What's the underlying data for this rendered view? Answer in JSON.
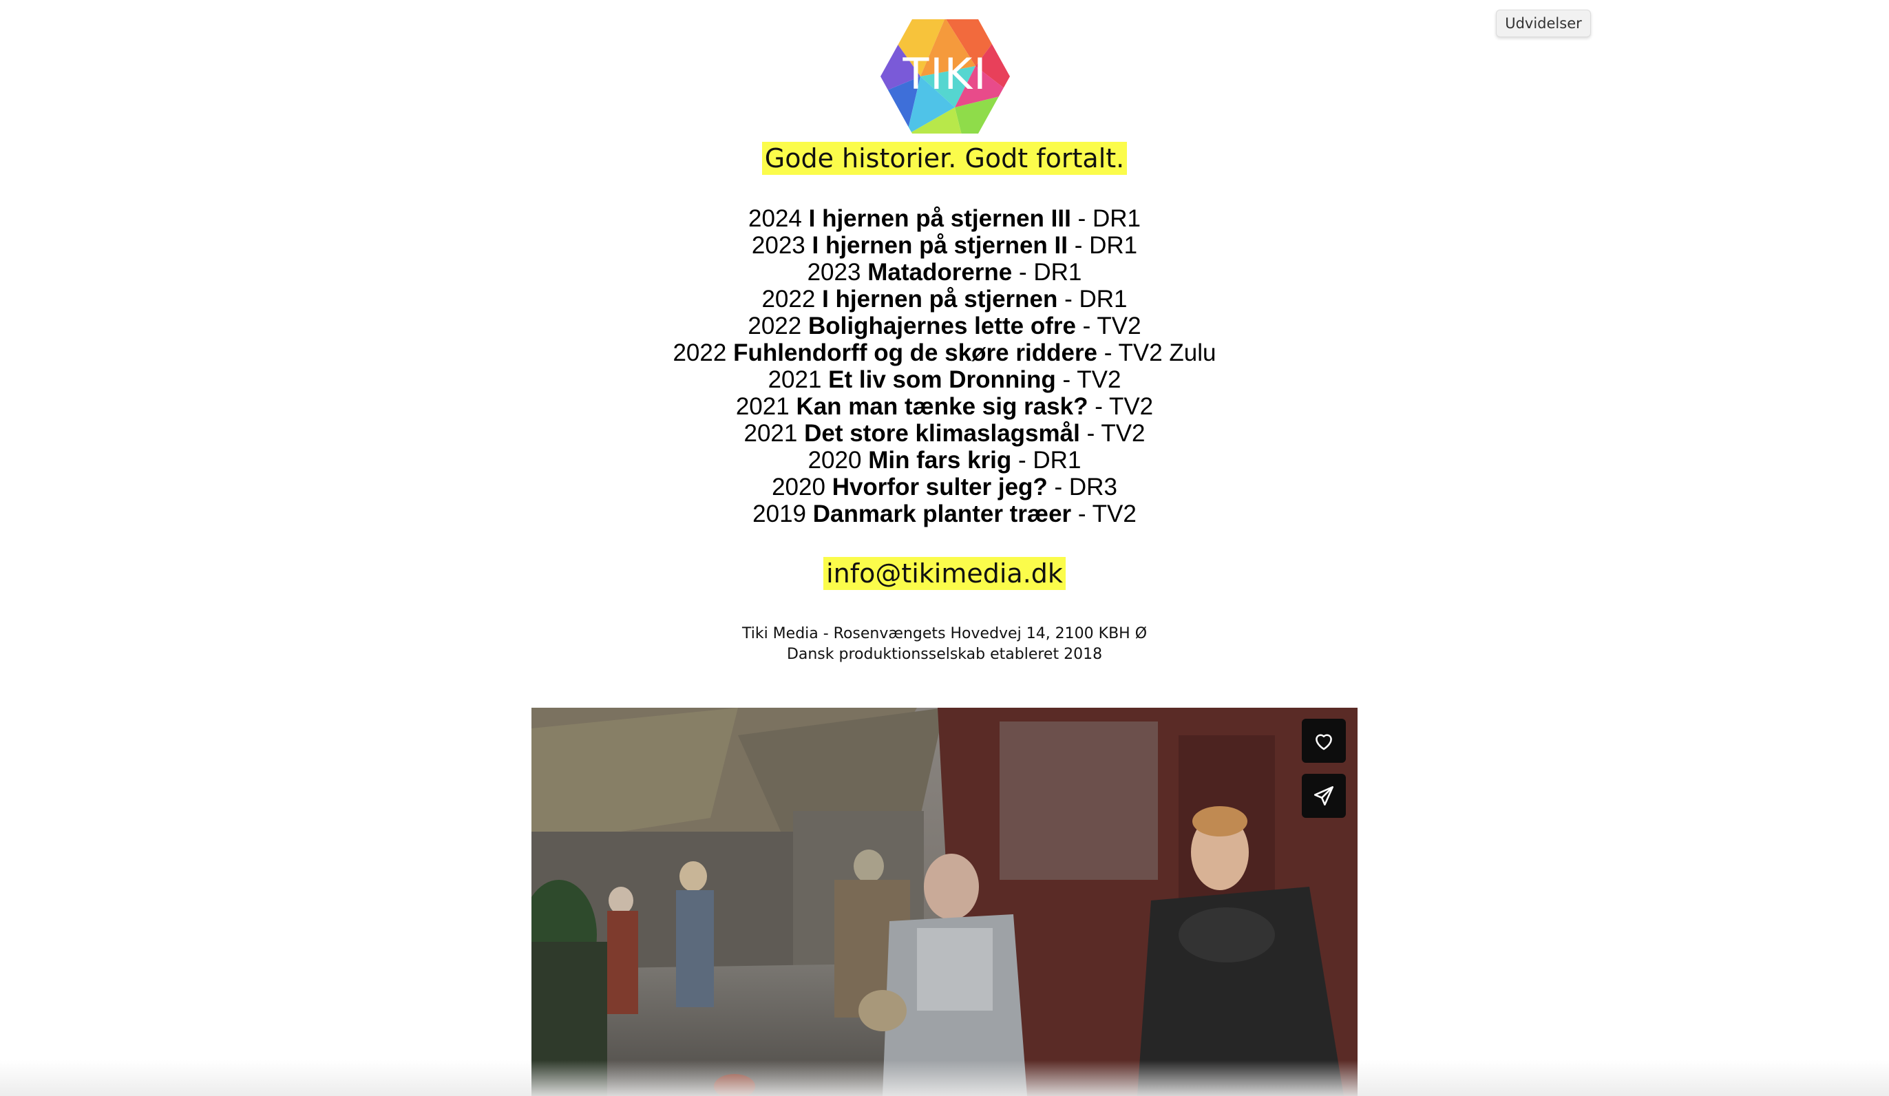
{
  "extension_button": {
    "label": "Udvidelser"
  },
  "logo": {
    "text": "TIKI"
  },
  "tagline": "Gode historier. Godt fortalt.",
  "productions": [
    {
      "year": "2024",
      "title": "I hjernen på stjernen III",
      "channel": " - DR1"
    },
    {
      "year": "2023",
      "title": "I hjernen på stjernen II",
      "channel": " - DR1"
    },
    {
      "year": "2023",
      "title": "Matadorerne",
      "channel": " - DR1"
    },
    {
      "year": "2022",
      "title": "I hjernen på stjernen",
      "channel": " - DR1"
    },
    {
      "year": "2022",
      "title": "Bolighajernes lette ofre",
      "channel": " - TV2"
    },
    {
      "year": "2022",
      "title": "Fuhlendorff og de skøre riddere",
      "channel": " - TV2 Zulu"
    },
    {
      "year": "2021",
      "title": "Et liv som Dronning",
      "channel": " - TV2"
    },
    {
      "year": "2021",
      "title": "Kan man tænke sig rask?",
      "channel": " - TV2"
    },
    {
      "year": "2021",
      "title": "Det store klimaslagsmål",
      "channel": " - TV2"
    },
    {
      "year": "2020",
      "title": "Min fars krig",
      "channel": " - DR1"
    },
    {
      "year": "2020",
      "title": "Hvorfor sulter jeg?",
      "channel": " - DR3"
    },
    {
      "year": "2019",
      "title": "Danmark planter træer",
      "channel": " - TV2"
    }
  ],
  "contact": {
    "email": "info@tikimedia.dk",
    "address_line": "Tiki Media - Rosenvængets Hovedvej 14, 2100 KBH Ø",
    "about_line": "Dansk produktionsselskab etableret 2018"
  },
  "media_actions": {
    "like_icon": "heart-icon",
    "share_icon": "send-icon"
  },
  "colors": {
    "highlight": "#fbfc4b",
    "icon_button_bg": "#0d0d0d"
  }
}
